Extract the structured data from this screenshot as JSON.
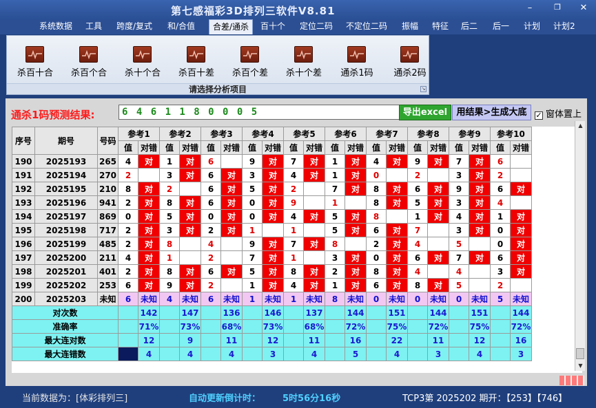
{
  "window": {
    "title": "第七感福彩3D排列三软件V8.81"
  },
  "menu": [
    "系统数据",
    "工具",
    "跨度/复式",
    "和/合值",
    "合差/通杀",
    "百十个",
    "定位二码",
    "不定位二码",
    "振幅",
    "特征",
    "后二",
    "后一",
    "计划",
    "计划2"
  ],
  "menu_active": "合差/通杀",
  "ribbon": {
    "buttons": [
      "杀百十合",
      "杀百个合",
      "杀十个合",
      "杀百十差",
      "杀百个差",
      "杀十个差",
      "通杀1码",
      "通杀2码"
    ],
    "caption": "请选择分析项目"
  },
  "prediction": {
    "label": "通杀1码预测结果:",
    "value": "6 4 6 1 1 8 0 0 0 5"
  },
  "buttons": {
    "export": "导出excel",
    "generate": "用结果>生成大底"
  },
  "ontop": {
    "label": "窗体置上",
    "checked": true,
    "mark": "✓"
  },
  "table": {
    "head_seq": "序号",
    "head_issue": "期号",
    "head_num": "号码",
    "refs": [
      "参考1",
      "参考2",
      "参考3",
      "参考4",
      "参考5",
      "参考6",
      "参考7",
      "参考8",
      "参考9",
      "参考10"
    ],
    "sub_val": "值",
    "sub_res": "对错",
    "hit_text": "对",
    "unknown_text": "未知",
    "rows": [
      {
        "seq": "190",
        "issue": "2025193",
        "num": "265",
        "cells": [
          [
            4,
            1
          ],
          [
            1,
            1
          ],
          [
            6,
            0
          ],
          [
            9,
            1
          ],
          [
            7,
            1
          ],
          [
            1,
            1
          ],
          [
            4,
            1
          ],
          [
            9,
            1
          ],
          [
            7,
            1
          ],
          [
            6,
            0
          ]
        ]
      },
      {
        "seq": "191",
        "issue": "2025194",
        "num": "270",
        "cells": [
          [
            2,
            0
          ],
          [
            3,
            1
          ],
          [
            6,
            1
          ],
          [
            3,
            1
          ],
          [
            4,
            1
          ],
          [
            1,
            1
          ],
          [
            0,
            0
          ],
          [
            2,
            0
          ],
          [
            3,
            1
          ],
          [
            2,
            0
          ]
        ]
      },
      {
        "seq": "192",
        "issue": "2025195",
        "num": "210",
        "cells": [
          [
            8,
            1
          ],
          [
            2,
            0
          ],
          [
            6,
            1
          ],
          [
            5,
            1
          ],
          [
            2,
            0
          ],
          [
            7,
            1
          ],
          [
            8,
            1
          ],
          [
            6,
            1
          ],
          [
            9,
            1
          ],
          [
            6,
            1
          ]
        ]
      },
      {
        "seq": "193",
        "issue": "2025196",
        "num": "941",
        "cells": [
          [
            2,
            1
          ],
          [
            8,
            1
          ],
          [
            6,
            1
          ],
          [
            0,
            1
          ],
          [
            9,
            0
          ],
          [
            1,
            0
          ],
          [
            8,
            1
          ],
          [
            5,
            1
          ],
          [
            3,
            1
          ],
          [
            4,
            0
          ]
        ]
      },
      {
        "seq": "194",
        "issue": "2025197",
        "num": "869",
        "cells": [
          [
            0,
            1
          ],
          [
            5,
            1
          ],
          [
            0,
            1
          ],
          [
            0,
            1
          ],
          [
            4,
            1
          ],
          [
            5,
            1
          ],
          [
            8,
            0
          ],
          [
            1,
            1
          ],
          [
            4,
            1
          ],
          [
            1,
            1
          ]
        ]
      },
      {
        "seq": "195",
        "issue": "2025198",
        "num": "717",
        "cells": [
          [
            2,
            1
          ],
          [
            3,
            1
          ],
          [
            2,
            1
          ],
          [
            1,
            0
          ],
          [
            1,
            0
          ],
          [
            5,
            1
          ],
          [
            6,
            1
          ],
          [
            7,
            0
          ],
          [
            3,
            1
          ],
          [
            0,
            1
          ]
        ]
      },
      {
        "seq": "196",
        "issue": "2025199",
        "num": "485",
        "cells": [
          [
            2,
            1
          ],
          [
            8,
            0
          ],
          [
            4,
            0
          ],
          [
            9,
            1
          ],
          [
            7,
            1
          ],
          [
            8,
            0
          ],
          [
            2,
            1
          ],
          [
            4,
            0
          ],
          [
            5,
            0
          ],
          [
            0,
            1
          ]
        ]
      },
      {
        "seq": "197",
        "issue": "2025200",
        "num": "211",
        "cells": [
          [
            4,
            1
          ],
          [
            1,
            0
          ],
          [
            2,
            0
          ],
          [
            7,
            1
          ],
          [
            1,
            0
          ],
          [
            3,
            1
          ],
          [
            0,
            1
          ],
          [
            6,
            1
          ],
          [
            7,
            1
          ],
          [
            6,
            1
          ]
        ]
      },
      {
        "seq": "198",
        "issue": "2025201",
        "num": "401",
        "cells": [
          [
            2,
            1
          ],
          [
            8,
            1
          ],
          [
            6,
            1
          ],
          [
            5,
            1
          ],
          [
            8,
            1
          ],
          [
            2,
            1
          ],
          [
            8,
            1
          ],
          [
            4,
            0
          ],
          [
            4,
            0
          ],
          [
            3,
            1
          ]
        ]
      },
      {
        "seq": "199",
        "issue": "2025202",
        "num": "253",
        "cells": [
          [
            6,
            1
          ],
          [
            9,
            1
          ],
          [
            2,
            0
          ],
          [
            1,
            1
          ],
          [
            4,
            1
          ],
          [
            1,
            1
          ],
          [
            6,
            1
          ],
          [
            8,
            1
          ],
          [
            5,
            0
          ],
          [
            2,
            0
          ]
        ]
      }
    ],
    "last_row": {
      "seq": "200",
      "issue": "2025203",
      "num": "未知",
      "vals": [
        6,
        4,
        6,
        1,
        1,
        8,
        0,
        0,
        0,
        5
      ]
    },
    "stats": [
      {
        "label": "对次数",
        "values": [
          "142",
          "147",
          "136",
          "146",
          "137",
          "144",
          "151",
          "144",
          "151",
          "144"
        ]
      },
      {
        "label": "准确率",
        "values": [
          "71%",
          "73%",
          "68%",
          "73%",
          "68%",
          "72%",
          "75%",
          "72%",
          "75%",
          "72%"
        ]
      },
      {
        "label": "最大连对数",
        "values": [
          "12",
          "9",
          "11",
          "12",
          "11",
          "16",
          "22",
          "11",
          "12",
          "16"
        ]
      },
      {
        "label": "最大连错数",
        "values": [
          "4",
          "4",
          "4",
          "3",
          "4",
          "5",
          "4",
          "3",
          "4",
          "3"
        ]
      }
    ]
  },
  "status": {
    "data_source": "当前数据为：[体彩排列三]",
    "countdown_label": "自动更新倒计时：",
    "countdown": "5时56分16秒",
    "issue_info": "TCP3第 2025202 期开：【253】【746】"
  },
  "colors": {
    "hit": "#f00000",
    "stats_bg": "#7ef2f2",
    "unknown_bg": "#f2c8f2",
    "brand_bg": "#1f3f7c"
  }
}
